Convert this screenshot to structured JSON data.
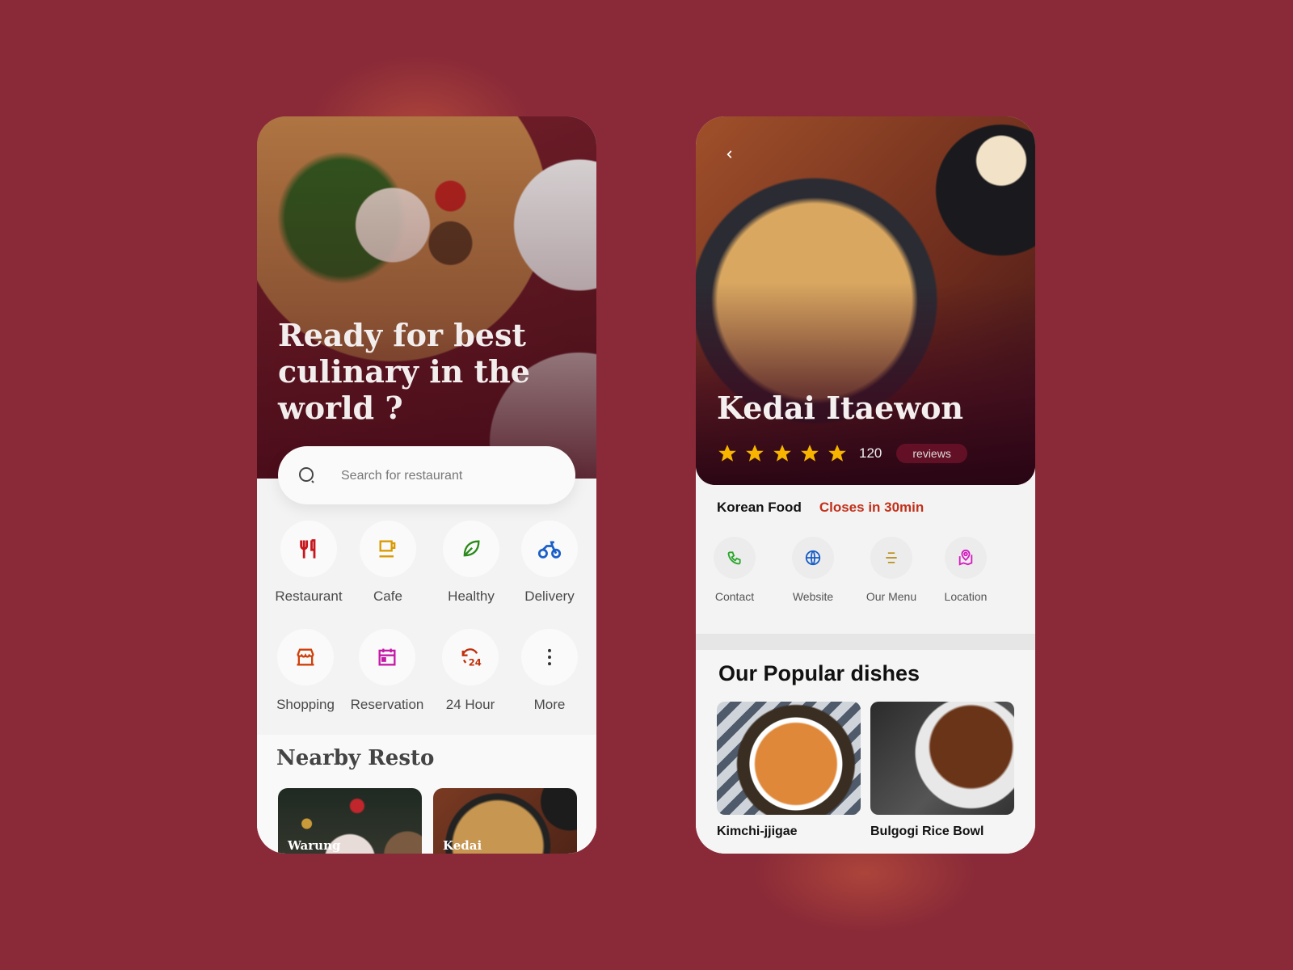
{
  "left_screen": {
    "hero": {
      "title": "Ready for best culinary in the world ?"
    },
    "search": {
      "placeholder": "Search for restaurant",
      "icon": "search-icon"
    },
    "categories": [
      {
        "label": "Restaurant",
        "icon": "fork-knife-icon",
        "color": "#c8161d"
      },
      {
        "label": "Cafe",
        "icon": "coffee-cup-icon",
        "color": "#d99a00"
      },
      {
        "label": "Healthy",
        "icon": "leaf-icon",
        "color": "#2a8a1a"
      },
      {
        "label": "Delivery",
        "icon": "motorbike-icon",
        "color": "#1a5fc8"
      },
      {
        "label": "Shopping",
        "icon": "store-icon",
        "color": "#d0400a"
      },
      {
        "label": "Reservation",
        "icon": "calendar-icon",
        "color": "#c41aa8"
      },
      {
        "label": "24 Hour",
        "icon": "clock-24-icon",
        "color": "#c0300a"
      },
      {
        "label": "More",
        "icon": "more-vertical-icon",
        "color": "#333333"
      }
    ],
    "nearby": {
      "title": "Nearby Resto",
      "items": [
        {
          "name": "Warung"
        },
        {
          "name": "Kedai"
        }
      ]
    }
  },
  "right_screen": {
    "back_icon": "chevron-left-icon",
    "restaurant": {
      "name": "Kedai Itaewon",
      "rating_stars": 5,
      "review_count": "120",
      "reviews_label": "reviews",
      "type": "Korean Food",
      "status": "Closes in 30min",
      "status_color": "#c2301a"
    },
    "actions": [
      {
        "label": "Contact",
        "icon": "phone-icon",
        "color": "#2aa52a"
      },
      {
        "label": "Website",
        "icon": "globe-icon",
        "color": "#1a5fc8"
      },
      {
        "label": "Our Menu",
        "icon": "menu-lines-icon",
        "color": "#b88a10"
      },
      {
        "label": "Location",
        "icon": "map-pin-icon",
        "color": "#d41ac0"
      }
    ],
    "popular": {
      "title": "Our Popular dishes",
      "dishes": [
        {
          "name": "Kimchi-jjigae"
        },
        {
          "name": "Bulgogi Rice Bowl"
        }
      ]
    }
  },
  "colors": {
    "background": "#8a2a38",
    "star": "#f7b500"
  }
}
